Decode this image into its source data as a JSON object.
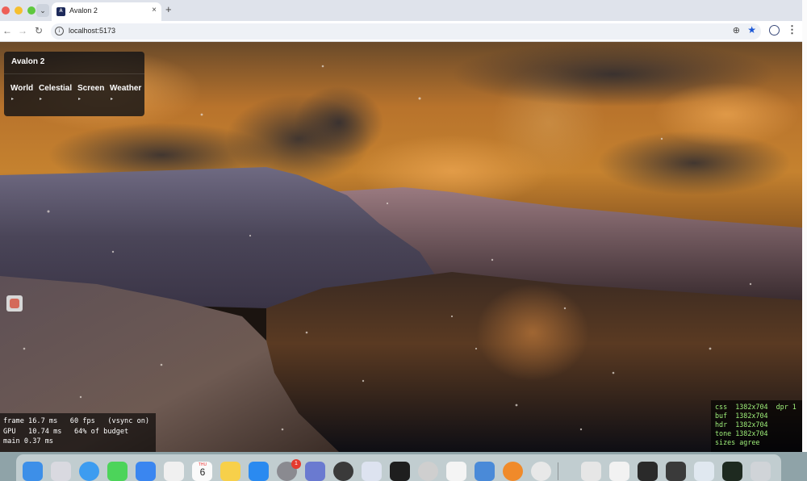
{
  "browser": {
    "tab_title": "Avalon 2",
    "tab_close": "×",
    "new_tab": "+",
    "url": "localhost:5173"
  },
  "panel": {
    "title": "Avalon 2",
    "menus": [
      {
        "label": "World",
        "caret": "▸"
      },
      {
        "label": "Celestial",
        "caret": "▸"
      },
      {
        "label": "Screen",
        "caret": "▸"
      },
      {
        "label": "Weather",
        "caret": "▸"
      }
    ]
  },
  "perf": {
    "line1": "frame 16.7 ms   60 fps   (vsync on)",
    "line2": "GPU   10.74 ms   64% of budget",
    "line3": "main 0.37 ms"
  },
  "sizes": {
    "line1": "css  1382x704  dpr 1",
    "line2": "buf  1382x704",
    "line3": "hdr  1382x704",
    "line4": "tone 1382x704",
    "line5": "sizes agree"
  },
  "dock": {
    "calendar_month": "THU",
    "calendar_day": "6",
    "badge": "1"
  },
  "colors": {
    "panel_bg": "#141416",
    "stats_green": "#9ff07a",
    "sky_orange": "#b8732c"
  }
}
